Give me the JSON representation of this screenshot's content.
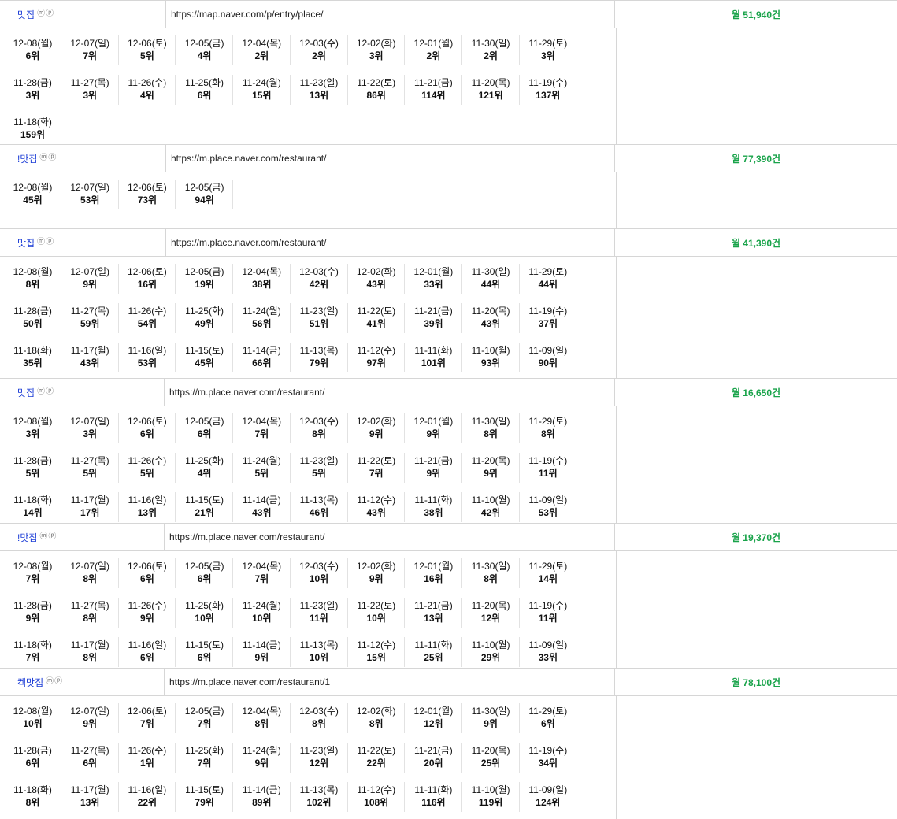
{
  "entries": [
    {
      "name": "맛집",
      "url": "https://map.naver.com/p/entry/place/",
      "volume": "월 51,940건",
      "ranks": [
        [
          "12-08(월)",
          "6위"
        ],
        [
          "12-07(일)",
          "7위"
        ],
        [
          "12-06(토)",
          "5위"
        ],
        [
          "12-05(금)",
          "4위"
        ],
        [
          "12-04(목)",
          "2위"
        ],
        [
          "12-03(수)",
          "2위"
        ],
        [
          "12-02(화)",
          "3위"
        ],
        [
          "12-01(월)",
          "2위"
        ],
        [
          "11-30(일)",
          "2위"
        ],
        [
          "11-29(토)",
          "3위"
        ],
        [
          "11-28(금)",
          "3위"
        ],
        [
          "11-27(목)",
          "3위"
        ],
        [
          "11-26(수)",
          "4위"
        ],
        [
          "11-25(화)",
          "6위"
        ],
        [
          "11-24(월)",
          "15위"
        ],
        [
          "11-23(일)",
          "13위"
        ],
        [
          "11-22(토)",
          "86위"
        ],
        [
          "11-21(금)",
          "114위"
        ],
        [
          "11-20(목)",
          "121위"
        ],
        [
          "11-19(수)",
          "137위"
        ],
        [
          "11-18(화)",
          "159위"
        ]
      ]
    },
    {
      "name": "!맛집",
      "url": "https://m.place.naver.com/restaurant/",
      "volume": "월 77,390건",
      "ranks": [
        [
          "12-08(월)",
          "45위"
        ],
        [
          "12-07(일)",
          "53위"
        ],
        [
          "12-06(토)",
          "73위"
        ],
        [
          "12-05(금)",
          "94위"
        ]
      ]
    },
    {
      "name": "맛집",
      "url": "https://m.place.naver.com/restaurant/",
      "volume": "월 41,390건",
      "ranks": [
        [
          "12-08(월)",
          "8위"
        ],
        [
          "12-07(일)",
          "9위"
        ],
        [
          "12-06(토)",
          "16위"
        ],
        [
          "12-05(금)",
          "19위"
        ],
        [
          "12-04(목)",
          "38위"
        ],
        [
          "12-03(수)",
          "42위"
        ],
        [
          "12-02(화)",
          "43위"
        ],
        [
          "12-01(월)",
          "33위"
        ],
        [
          "11-30(일)",
          "44위"
        ],
        [
          "11-29(토)",
          "44위"
        ],
        [
          "11-28(금)",
          "50위"
        ],
        [
          "11-27(목)",
          "59위"
        ],
        [
          "11-26(수)",
          "54위"
        ],
        [
          "11-25(화)",
          "49위"
        ],
        [
          "11-24(월)",
          "56위"
        ],
        [
          "11-23(일)",
          "51위"
        ],
        [
          "11-22(토)",
          "41위"
        ],
        [
          "11-21(금)",
          "39위"
        ],
        [
          "11-20(목)",
          "43위"
        ],
        [
          "11-19(수)",
          "37위"
        ],
        [
          "11-18(화)",
          "35위"
        ],
        [
          "11-17(월)",
          "43위"
        ],
        [
          "11-16(일)",
          "53위"
        ],
        [
          "11-15(토)",
          "45위"
        ],
        [
          "11-14(금)",
          "66위"
        ],
        [
          "11-13(목)",
          "79위"
        ],
        [
          "11-12(수)",
          "97위"
        ],
        [
          "11-11(화)",
          "101위"
        ],
        [
          "11-10(월)",
          "93위"
        ],
        [
          "11-09(일)",
          "90위"
        ]
      ]
    },
    {
      "name": "맛집",
      "url": "https://m.place.naver.com/restaurant/",
      "volume": "월 16,650건",
      "ranks": [
        [
          "12-08(월)",
          "3위"
        ],
        [
          "12-07(일)",
          "3위"
        ],
        [
          "12-06(토)",
          "6위"
        ],
        [
          "12-05(금)",
          "6위"
        ],
        [
          "12-04(목)",
          "7위"
        ],
        [
          "12-03(수)",
          "8위"
        ],
        [
          "12-02(화)",
          "9위"
        ],
        [
          "12-01(월)",
          "9위"
        ],
        [
          "11-30(일)",
          "8위"
        ],
        [
          "11-29(토)",
          "8위"
        ],
        [
          "11-28(금)",
          "5위"
        ],
        [
          "11-27(목)",
          "5위"
        ],
        [
          "11-26(수)",
          "5위"
        ],
        [
          "11-25(화)",
          "4위"
        ],
        [
          "11-24(월)",
          "5위"
        ],
        [
          "11-23(일)",
          "5위"
        ],
        [
          "11-22(토)",
          "7위"
        ],
        [
          "11-21(금)",
          "9위"
        ],
        [
          "11-20(목)",
          "9위"
        ],
        [
          "11-19(수)",
          "11위"
        ],
        [
          "11-18(화)",
          "14위"
        ],
        [
          "11-17(월)",
          "17위"
        ],
        [
          "11-16(일)",
          "13위"
        ],
        [
          "11-15(토)",
          "21위"
        ],
        [
          "11-14(금)",
          "43위"
        ],
        [
          "11-13(목)",
          "46위"
        ],
        [
          "11-12(수)",
          "43위"
        ],
        [
          "11-11(화)",
          "38위"
        ],
        [
          "11-10(월)",
          "42위"
        ],
        [
          "11-09(일)",
          "53위"
        ]
      ]
    },
    {
      "name": "!맛집",
      "url": "https://m.place.naver.com/restaurant/",
      "volume": "월 19,370건",
      "ranks": [
        [
          "12-08(월)",
          "7위"
        ],
        [
          "12-07(일)",
          "8위"
        ],
        [
          "12-06(토)",
          "6위"
        ],
        [
          "12-05(금)",
          "6위"
        ],
        [
          "12-04(목)",
          "7위"
        ],
        [
          "12-03(수)",
          "10위"
        ],
        [
          "12-02(화)",
          "9위"
        ],
        [
          "12-01(월)",
          "16위"
        ],
        [
          "11-30(일)",
          "8위"
        ],
        [
          "11-29(토)",
          "14위"
        ],
        [
          "11-28(금)",
          "9위"
        ],
        [
          "11-27(목)",
          "8위"
        ],
        [
          "11-26(수)",
          "9위"
        ],
        [
          "11-25(화)",
          "10위"
        ],
        [
          "11-24(월)",
          "10위"
        ],
        [
          "11-23(일)",
          "11위"
        ],
        [
          "11-22(토)",
          "10위"
        ],
        [
          "11-21(금)",
          "13위"
        ],
        [
          "11-20(목)",
          "12위"
        ],
        [
          "11-19(수)",
          "11위"
        ],
        [
          "11-18(화)",
          "7위"
        ],
        [
          "11-17(월)",
          "8위"
        ],
        [
          "11-16(일)",
          "6위"
        ],
        [
          "11-15(토)",
          "6위"
        ],
        [
          "11-14(금)",
          "9위"
        ],
        [
          "11-13(목)",
          "10위"
        ],
        [
          "11-12(수)",
          "15위"
        ],
        [
          "11-11(화)",
          "25위"
        ],
        [
          "11-10(월)",
          "29위"
        ],
        [
          "11-09(일)",
          "33위"
        ]
      ]
    },
    {
      "name": "켁맛집",
      "url": "https://m.place.naver.com/restaurant/1",
      "volume": "월 78,100건",
      "ranks": [
        [
          "12-08(월)",
          "10위"
        ],
        [
          "12-07(일)",
          "9위"
        ],
        [
          "12-06(토)",
          "7위"
        ],
        [
          "12-05(금)",
          "7위"
        ],
        [
          "12-04(목)",
          "8위"
        ],
        [
          "12-03(수)",
          "8위"
        ],
        [
          "12-02(화)",
          "8위"
        ],
        [
          "12-01(월)",
          "12위"
        ],
        [
          "11-30(일)",
          "9위"
        ],
        [
          "11-29(토)",
          "6위"
        ],
        [
          "11-28(금)",
          "6위"
        ],
        [
          "11-27(목)",
          "6위"
        ],
        [
          "11-26(수)",
          "1위"
        ],
        [
          "11-25(화)",
          "7위"
        ],
        [
          "11-24(월)",
          "9위"
        ],
        [
          "11-23(일)",
          "12위"
        ],
        [
          "11-22(토)",
          "22위"
        ],
        [
          "11-21(금)",
          "20위"
        ],
        [
          "11-20(목)",
          "25위"
        ],
        [
          "11-19(수)",
          "34위"
        ],
        [
          "11-18(화)",
          "8위"
        ],
        [
          "11-17(월)",
          "13위"
        ],
        [
          "11-16(일)",
          "22위"
        ],
        [
          "11-15(토)",
          "79위"
        ],
        [
          "11-14(금)",
          "89위"
        ],
        [
          "11-13(목)",
          "102위"
        ],
        [
          "11-12(수)",
          "108위"
        ],
        [
          "11-11(화)",
          "116위"
        ],
        [
          "11-10(월)",
          "119위"
        ],
        [
          "11-09(일)",
          "124위"
        ]
      ]
    }
  ],
  "colors": {
    "link": "#1a3bd6",
    "volume": "#19a34a",
    "grid": "#d6d6d6"
  },
  "icons": {
    "badge_m": "ⓜ",
    "badge_p": "ⓟ"
  }
}
